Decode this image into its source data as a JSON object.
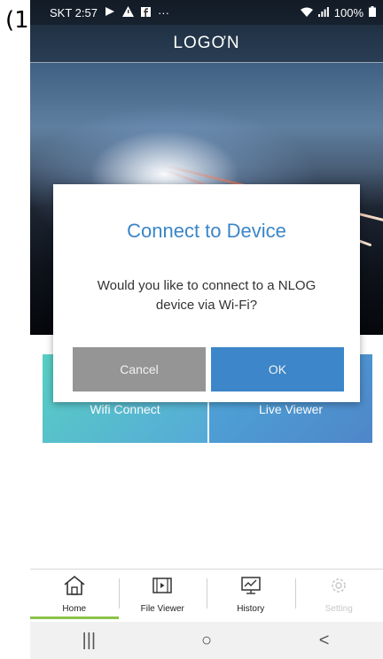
{
  "annotation": {
    "label": "(1"
  },
  "status_bar": {
    "carrier_time": "SKT 2:57",
    "more_indicator": "···",
    "battery": "100%",
    "icons": [
      "cast-icon",
      "alert-icon",
      "facebook-icon",
      "wifi-icon",
      "signal-icon",
      "battery-icon"
    ]
  },
  "header": {
    "brand": "LOGƠN"
  },
  "dialog": {
    "title": "Connect to Device",
    "message": "Would you like to connect to a NLOG device via Wi-Fi?",
    "cancel_label": "Cancel",
    "ok_label": "OK"
  },
  "tiles": {
    "wifi_connect": "Wifi Connect",
    "live_viewer": "Live Viewer"
  },
  "bottom_nav": {
    "items": [
      {
        "label": "Home",
        "icon": "home-icon",
        "active": true
      },
      {
        "label": "File Viewer",
        "icon": "film-icon",
        "active": false
      },
      {
        "label": "History",
        "icon": "chart-icon",
        "active": false
      },
      {
        "label": "Setting",
        "icon": "gear-icon",
        "active": false
      }
    ]
  },
  "system_nav": {
    "recents": "|||",
    "home": "○",
    "back": "<"
  },
  "colors": {
    "accent_blue": "#3c86c9",
    "cancel_gray": "#959595",
    "active_underline": "#8bc34a",
    "dialog_title": "#3a86c8"
  }
}
